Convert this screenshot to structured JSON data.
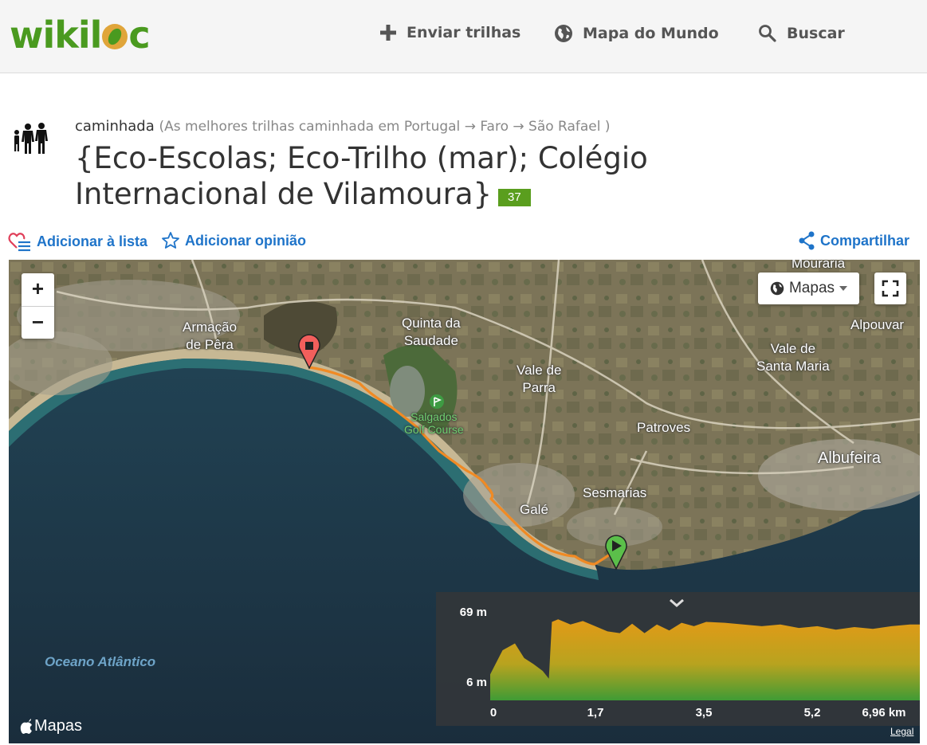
{
  "header": {
    "logo_text_pre": "wikil",
    "logo_text_post": "c",
    "nav": {
      "upload": "Enviar trilhas",
      "world_map": "Mapa do Mundo",
      "search": "Buscar"
    }
  },
  "trail": {
    "activity": "caminhada",
    "breadcrumb": "(As melhores trilhas caminhada em Portugal → Faro → São Rafael )",
    "title": "{Eco-Escolas; Eco-Trilho (mar); Colégio Internacional de Vilamoura}",
    "badge": "37"
  },
  "actions": {
    "add_to_list": "Adicionar à lista",
    "add_review": "Adicionar opinião",
    "share": "Compartilhar"
  },
  "map": {
    "zoom_in": "+",
    "zoom_out": "−",
    "layers_label": "Mapas",
    "provider": "Mapas",
    "legal": "Legal",
    "ocean_label": "Oceano Atlântico",
    "places": {
      "mouraria": "Mouraria",
      "armacao": "Armação\nde Pêra",
      "quinta": "Quinta da\nSaudade",
      "vale_parra": "Vale de\nParra",
      "alpouvar": "Alpouvar",
      "vale_santa_maria": "Vale de\nSanta Maria",
      "salgados": "Salgados\nGolf Course",
      "patroves": "Patroves",
      "albufeira": "Albufeira",
      "sesmarias": "Sesmarias",
      "gale": "Galé"
    }
  },
  "chart_data": {
    "type": "area",
    "title": "",
    "xlabel": "",
    "ylabel": "",
    "x_ticks": [
      "0",
      "1,7",
      "3,5",
      "5,2",
      "6,96 km"
    ],
    "y_ticks": [
      "69 m",
      "6 m"
    ],
    "xlim": [
      0,
      6.96
    ],
    "ylim": [
      6,
      69
    ],
    "x": [
      0,
      0.2,
      0.4,
      0.55,
      0.7,
      0.85,
      0.95,
      1.0,
      1.1,
      1.3,
      1.5,
      1.7,
      1.9,
      2.1,
      2.3,
      2.5,
      2.7,
      2.9,
      3.1,
      3.3,
      3.5,
      3.8,
      4.1,
      4.4,
      4.7,
      5.0,
      5.3,
      5.6,
      5.9,
      6.2,
      6.5,
      6.8,
      6.96
    ],
    "y": [
      14,
      42,
      50,
      33,
      26,
      18,
      9,
      75,
      78,
      72,
      76,
      70,
      64,
      62,
      73,
      62,
      72,
      65,
      74,
      70,
      75,
      74,
      72,
      70,
      72,
      68,
      70,
      66,
      69,
      67,
      70,
      72,
      72
    ]
  }
}
